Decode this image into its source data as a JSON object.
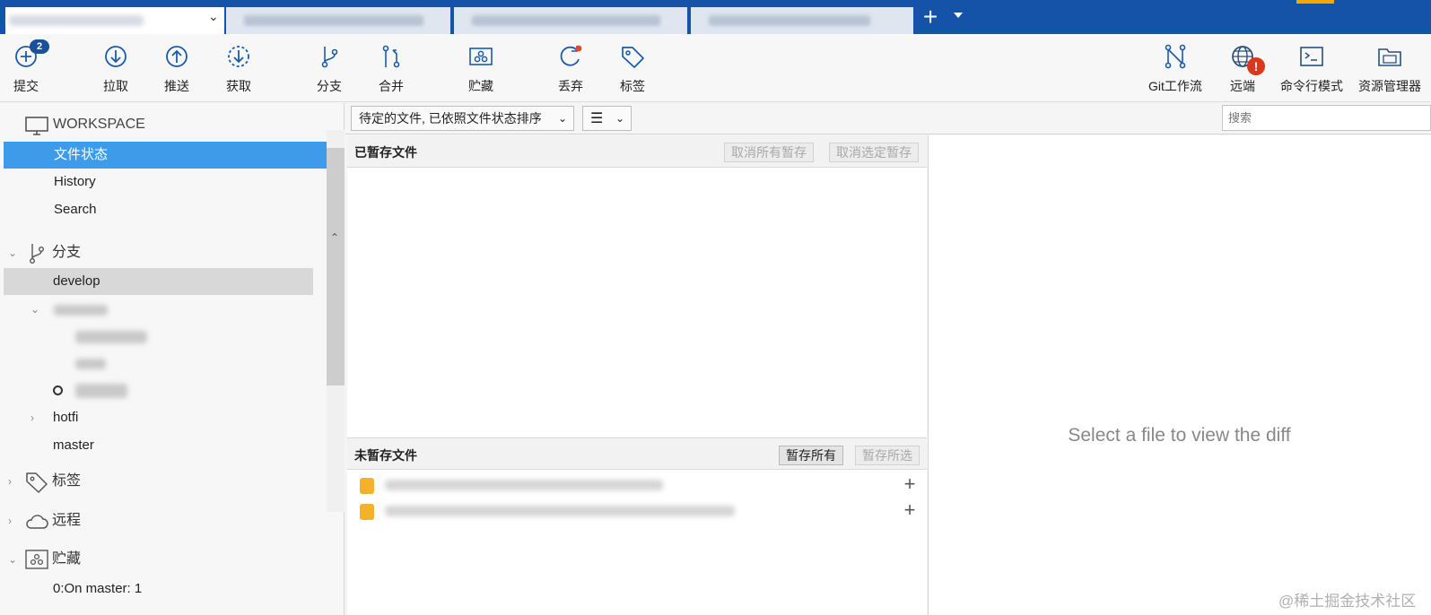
{
  "toolbar": {
    "commit": {
      "label": "提交",
      "badge": "2"
    },
    "pull": "拉取",
    "push": "推送",
    "fetch": "获取",
    "branch": "分支",
    "merge": "合并",
    "stash": "贮藏",
    "discard": "丢弃",
    "tag": "标签",
    "git_flow": "Git工作流",
    "remote": {
      "label": "远端",
      "alert": "!"
    },
    "terminal": "命令行模式",
    "explorer": "资源管理器"
  },
  "sidebar": {
    "workspace": "WORKSPACE",
    "file_status": "文件状态",
    "history": "History",
    "search": "Search",
    "branches_header": "分支",
    "branches": {
      "develop": "develop",
      "hotfix": "hotfi",
      "master": "master"
    },
    "tags_header": "标签",
    "remotes_header": "远程",
    "stashes_header": "贮藏",
    "stash_item": "0:On master: 1"
  },
  "filter": {
    "sort_label": "待定的文件, 已依照文件状态排序",
    "view_icon": "list-icon",
    "search_placeholder": "搜索"
  },
  "staged": {
    "title": "已暂存文件",
    "unstage_all": "取消所有暂存",
    "unstage_selected": "取消选定暂存"
  },
  "unstaged": {
    "title": "未暂存文件",
    "stage_all": "暂存所有",
    "stage_selected": "暂存所选"
  },
  "diff": {
    "placeholder": "Select a file to view the diff"
  },
  "watermark": "@稀土掘金技术社区",
  "colors": {
    "titlebar": "#1453a8",
    "selection": "#3d9be9",
    "icon": "#1a5aa8",
    "alert": "#d9371e"
  }
}
